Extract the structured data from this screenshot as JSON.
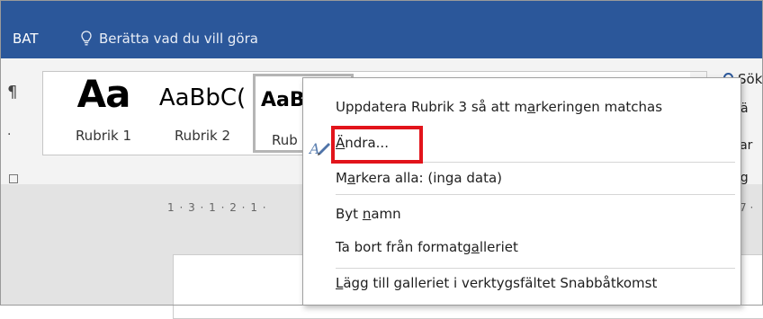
{
  "titlebar": {
    "app_fragment": "BAT",
    "tellme": "Berätta vad du vill göra"
  },
  "ribbon": {
    "pilcrow": "¶",
    "styles": [
      {
        "sample": "Aa",
        "label": "Rubrik 1"
      },
      {
        "sample": "AaBbC(",
        "label": "Rubrik 2"
      },
      {
        "sample": "AaB",
        "label": "Rub"
      }
    ],
    "right": {
      "search": "Sök",
      "item1": "rsä",
      "item2": "Mar",
      "item3": "dig"
    }
  },
  "ruler": {
    "text": "1 · 3 · 1 · 2 · 1 ·",
    "right": "7 ·"
  },
  "context_menu": {
    "items": [
      {
        "pre": "Uppdatera Rubrik 3 så att m",
        "u": "a",
        "post": "rkeringen matchas"
      },
      {
        "pre": "",
        "u": "Ä",
        "post": "ndra..."
      },
      {
        "pre": "M",
        "u": "a",
        "post": "rkera alla: (inga data)"
      },
      {
        "pre": "Byt ",
        "u": "n",
        "post": "amn"
      },
      {
        "pre": "Ta bort från formatg",
        "u": "a",
        "post": "lleriet"
      },
      {
        "pre": "",
        "u": "L",
        "post": "ägg till galleriet i verktygsfältet Snabbåtkomst"
      }
    ]
  },
  "colors": {
    "titlebar": "#2b579a",
    "highlight": "#e2141b"
  },
  "icons": {
    "tellme": "lightbulb-icon",
    "search": "search-icon",
    "edit": "pen-style-icon"
  }
}
